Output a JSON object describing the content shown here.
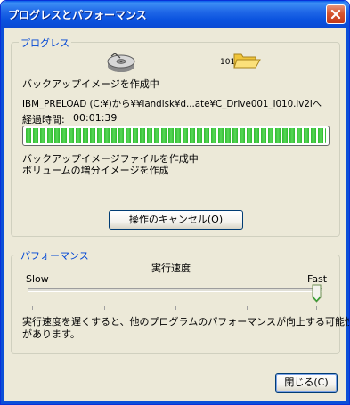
{
  "window": {
    "title": "プログレスとパフォーマンス"
  },
  "progress_group": {
    "label": "プログレス",
    "operation_text": "バックアップイメージを作成中",
    "path_text": "IBM_PRELOAD (C:¥)から¥¥landisk¥d...ate¥C_Drive001_i010.iv2iへ",
    "elapsed_label": "経過時間:",
    "elapsed_value": "00:01:39",
    "progress_fraction": 1.0,
    "status_line1": "バックアップイメージファイルを作成中",
    "status_line2": "ボリュームの増分イメージを作成",
    "cancel_button": "操作のキャンセル(O)",
    "binary_icon_text": "1010",
    "icons": [
      "disk-drive-icon",
      "folder-icon"
    ]
  },
  "performance_group": {
    "label": "パフォーマンス",
    "speed_label": "実行速度",
    "slow_label": "Slow",
    "fast_label": "Fast",
    "slider_value": 1.0,
    "description_line1": "実行速度を遅くすると、他のプログラムのパフォーマンスが向上する可能性",
    "description_line2": "があります。"
  },
  "close_button": "閉じる(C)",
  "colors": {
    "accent": "#0046d5",
    "progress_green": "#2fba2f",
    "titlebar": "#0b53df"
  }
}
